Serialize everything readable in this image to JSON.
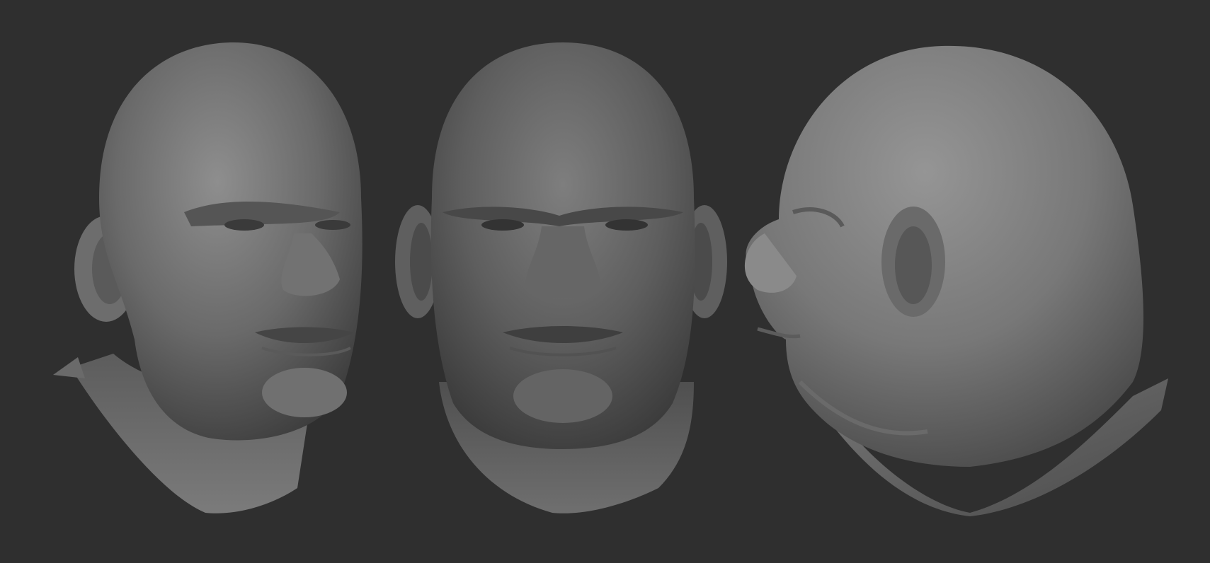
{
  "scene": {
    "background_color": "#2f2f2f",
    "views": [
      {
        "id": "three-quarter",
        "icon": "sculpt-head-three-quarter"
      },
      {
        "id": "front",
        "icon": "sculpt-head-front"
      },
      {
        "id": "side",
        "icon": "sculpt-head-profile"
      }
    ]
  }
}
